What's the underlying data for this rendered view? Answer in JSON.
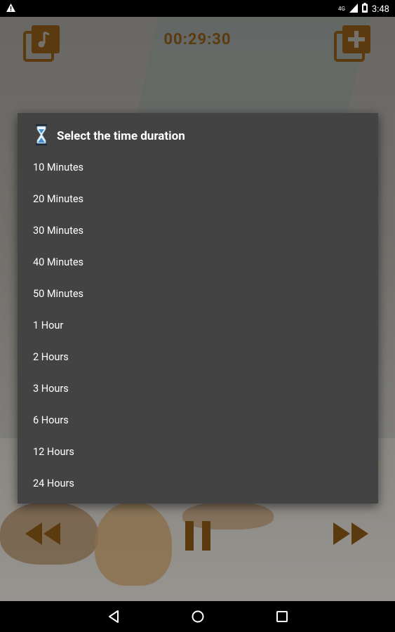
{
  "status_bar": {
    "time": "3:48",
    "network": "4G",
    "icons": [
      "warning-icon",
      "signal-icon",
      "battery-icon"
    ]
  },
  "app": {
    "timer": "00:29:30",
    "accent_color": "#7b4e16"
  },
  "dialog": {
    "title": "Select the time duration",
    "icon": "hourglass-icon",
    "options": [
      "10 Minutes",
      "20 Minutes",
      "30 Minutes",
      "40 Minutes",
      "50 Minutes",
      "1 Hour",
      "2 Hours",
      "3 Hours",
      "6 Hours",
      "12 Hours",
      "24 Hours"
    ]
  },
  "nav_bar": {
    "buttons": [
      "back-icon",
      "home-icon",
      "recents-icon"
    ]
  }
}
